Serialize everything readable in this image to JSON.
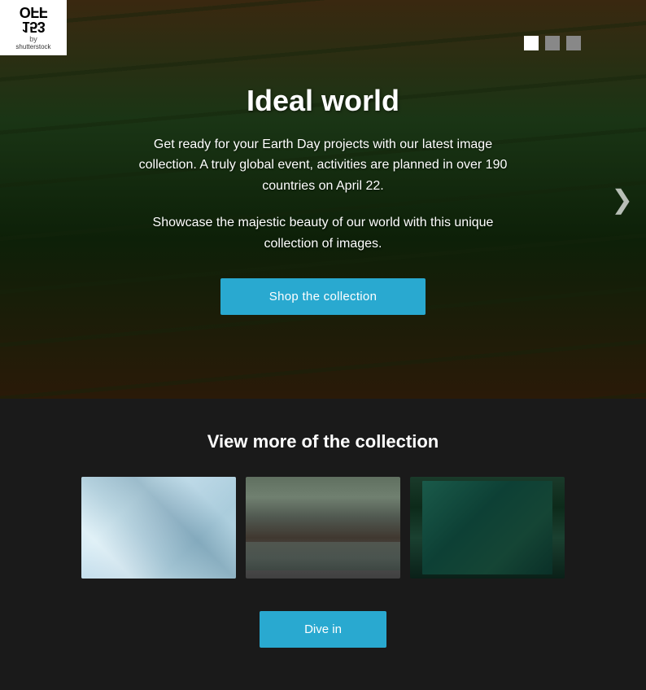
{
  "logo": {
    "text_main": "OFF",
    "text_secondary": "153",
    "text_by": "by",
    "text_brand": "shutterstock"
  },
  "hero": {
    "title": "Ideal world",
    "description": "Get ready for your Earth Day projects with our latest image collection. A truly global event, activities are planned in over 190 countries on April 22.",
    "sub_description": "Showcase the majestic beauty of our world with this unique collection of images.",
    "cta_label": "Shop the collection"
  },
  "carousel": {
    "dots": [
      {
        "label": "slide 1",
        "active": true
      },
      {
        "label": "slide 2",
        "active": false
      },
      {
        "label": "slide 3",
        "active": false
      }
    ],
    "next_arrow": "❯"
  },
  "collection": {
    "section_title": "View more of the collection",
    "images": [
      {
        "alt": "Ice glacier image",
        "type": "ice"
      },
      {
        "alt": "Rocky landscape with water",
        "type": "rocks"
      },
      {
        "alt": "Children at aquarium",
        "type": "aquarium"
      }
    ],
    "cta_label": "Dive in"
  }
}
